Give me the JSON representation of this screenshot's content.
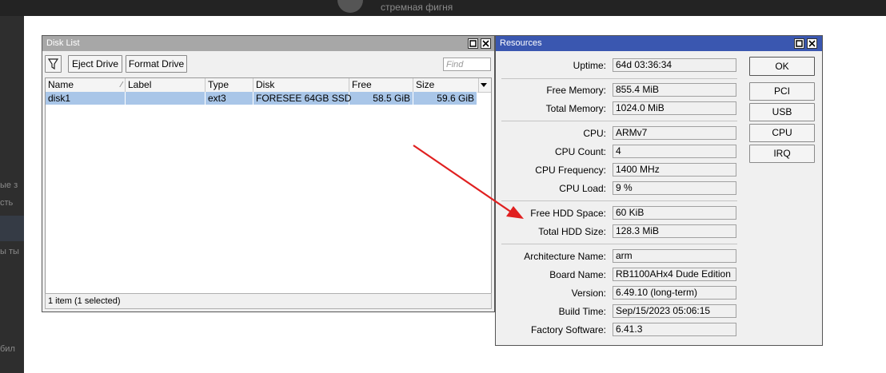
{
  "background": {
    "chat_header_text": "стремная фигня",
    "left_snippets": [
      "ые з",
      "сть",
      "ы ты",
      "бил"
    ]
  },
  "disk_list": {
    "title": "Disk List",
    "toolbar": {
      "eject_label": "Eject Drive",
      "format_label": "Format Drive",
      "find_placeholder": "Find"
    },
    "columns": [
      "Name",
      "Label",
      "Type",
      "Disk",
      "Free",
      "Size"
    ],
    "rows": [
      {
        "name": "disk1",
        "label": "",
        "type": "ext3",
        "disk": "FORESEE 64GB SSD",
        "free": "58.5 GiB",
        "size": "59.6 GiB"
      }
    ],
    "status": "1 item (1 selected)"
  },
  "resources": {
    "title": "Resources",
    "fields": [
      {
        "label": "Uptime:",
        "value": "64d 03:36:34"
      },
      {
        "label": "Free Memory:",
        "value": "855.4 MiB"
      },
      {
        "label": "Total Memory:",
        "value": "1024.0 MiB"
      },
      {
        "label": "CPU:",
        "value": "ARMv7"
      },
      {
        "label": "CPU Count:",
        "value": "4"
      },
      {
        "label": "CPU Frequency:",
        "value": "1400 MHz"
      },
      {
        "label": "CPU Load:",
        "value": "9 %"
      },
      {
        "label": "Free HDD Space:",
        "value": "60 KiB"
      },
      {
        "label": "Total HDD Size:",
        "value": "128.3 MiB"
      },
      {
        "label": "Architecture Name:",
        "value": "arm"
      },
      {
        "label": "Board Name:",
        "value": "RB1100AHx4 Dude Edition"
      },
      {
        "label": "Version:",
        "value": "6.49.10 (long-term)"
      },
      {
        "label": "Build Time:",
        "value": "Sep/15/2023 05:06:15"
      },
      {
        "label": "Factory Software:",
        "value": "6.41.3"
      }
    ],
    "buttons": {
      "ok": "OK",
      "pci": "PCI",
      "usb": "USB",
      "cpu": "CPU",
      "irq": "IRQ"
    }
  },
  "colors": {
    "disk_list_titlebar": "#a7a7a7",
    "resources_titlebar": "#3a57b0",
    "selected_row": "#a9c6e8",
    "annotation_arrow": "#e02020"
  },
  "icons": [
    "filter-icon",
    "sort-icon",
    "column-menu-icon",
    "maximize-icon",
    "close-icon",
    "arrow-annotation-icon"
  ]
}
